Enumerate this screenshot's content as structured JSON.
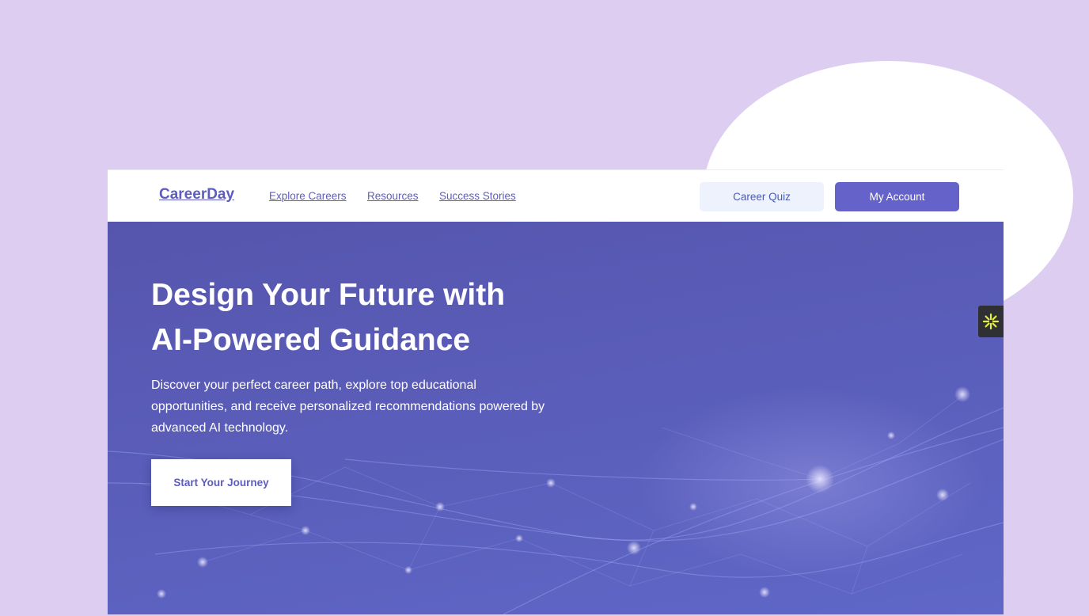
{
  "nav": {
    "logo": "CareerDay",
    "links": [
      {
        "label": "Explore Careers"
      },
      {
        "label": "Resources"
      },
      {
        "label": "Success Stories"
      }
    ],
    "quiz_button": "Career Quiz",
    "account_button": "My Account"
  },
  "hero": {
    "title_line1": "Design Your Future with",
    "title_line2": "AI-Powered Guidance",
    "subtitle": "Discover your perfect career path, explore top educational opportunities, and receive personalized recommendations powered by advanced AI technology.",
    "cta": "Start Your Journey"
  },
  "widget": {
    "icon": "sparkle-icon"
  },
  "colors": {
    "page_background": "#ddcdf1",
    "brand": "#5d5cc0",
    "hero_background": "#5a5cb8",
    "account_button": "#6563c9",
    "quiz_button": "#eef2fc",
    "widget_background": "#2e3033",
    "widget_icon": "#e6f03c"
  }
}
